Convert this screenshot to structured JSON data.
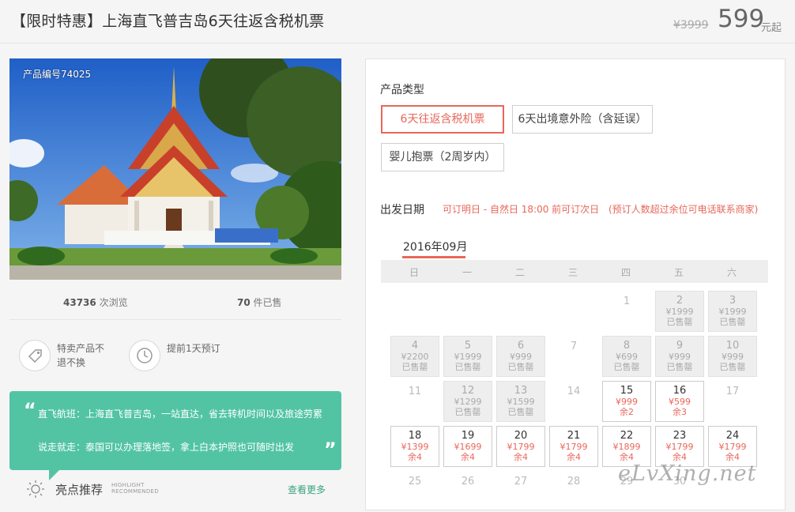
{
  "header": {
    "title": "【限时特惠】上海直飞普吉岛6天往返含税机票",
    "original_price": "¥3999",
    "price": "599",
    "price_unit": "元起"
  },
  "gallery": {
    "product_code": "产品编号74025"
  },
  "stats": {
    "views_count": "43736",
    "views_label": "次浏览",
    "sold_count": "70",
    "sold_label": "件已售"
  },
  "features": [
    {
      "icon": "tag-icon",
      "text": "特卖产品不退不换"
    },
    {
      "icon": "clock-icon",
      "text": "提前1天预订"
    }
  ],
  "quote": {
    "line1": "直飞航班：上海直飞普吉岛，一站直达，省去转机时间以及旅途劳累",
    "line2": "说走就走：泰国可以办理落地签，拿上白本护照也可随时出发"
  },
  "highlights": {
    "icon": "sun-icon",
    "title": "亮点推荐",
    "subtitle_en_1": "HIGHLIGHT",
    "subtitle_en_2": "RECOMMENDED",
    "more": "查看更多"
  },
  "booking": {
    "product_type_label": "产品类型",
    "options": [
      {
        "label": "6天往返含税机票",
        "selected": true
      },
      {
        "label": "6天出境意外险（含延误）",
        "selected": false
      },
      {
        "label": "婴儿抱票（2周岁内）",
        "selected": false
      }
    ],
    "depart_label": "出发日期",
    "depart_note1": "可订明日 - 自然日 18:00 前可订次日",
    "depart_note2": "(预订人数超过余位可电话联系商家)",
    "month": "2016年09月",
    "weekdays": [
      "日",
      "一",
      "二",
      "三",
      "四",
      "五",
      "六"
    ],
    "days": [
      {
        "day": "1",
        "state": "plain",
        "col": 4,
        "row": 0
      },
      {
        "day": "2",
        "state": "soldout",
        "price": "¥1999",
        "note": "已售罄",
        "col": 5,
        "row": 0
      },
      {
        "day": "3",
        "state": "soldout",
        "price": "¥1999",
        "note": "已售罄",
        "col": 6,
        "row": 0
      },
      {
        "day": "4",
        "state": "soldout",
        "price": "¥2200",
        "note": "已售罄",
        "col": 0,
        "row": 1
      },
      {
        "day": "5",
        "state": "soldout",
        "price": "¥1999",
        "note": "已售罄",
        "col": 1,
        "row": 1
      },
      {
        "day": "6",
        "state": "soldout",
        "price": "¥999",
        "note": "已售罄",
        "col": 2,
        "row": 1
      },
      {
        "day": "7",
        "state": "plain",
        "col": 3,
        "row": 1
      },
      {
        "day": "8",
        "state": "soldout",
        "price": "¥699",
        "note": "已售罄",
        "col": 4,
        "row": 1
      },
      {
        "day": "9",
        "state": "soldout",
        "price": "¥999",
        "note": "已售罄",
        "col": 5,
        "row": 1
      },
      {
        "day": "10",
        "state": "soldout",
        "price": "¥999",
        "note": "已售罄",
        "col": 6,
        "row": 1
      },
      {
        "day": "11",
        "state": "plain",
        "col": 0,
        "row": 2
      },
      {
        "day": "12",
        "state": "soldout",
        "price": "¥1299",
        "note": "已售罄",
        "col": 1,
        "row": 2
      },
      {
        "day": "13",
        "state": "soldout",
        "price": "¥1599",
        "note": "已售罄",
        "col": 2,
        "row": 2
      },
      {
        "day": "14",
        "state": "plain",
        "col": 3,
        "row": 2
      },
      {
        "day": "15",
        "state": "avail",
        "price": "¥999",
        "note": "余2",
        "col": 4,
        "row": 2
      },
      {
        "day": "16",
        "state": "avail",
        "price": "¥599",
        "note": "余3",
        "col": 5,
        "row": 2
      },
      {
        "day": "17",
        "state": "plain",
        "col": 6,
        "row": 2
      },
      {
        "day": "18",
        "state": "avail",
        "price": "¥1399",
        "note": "余4",
        "col": 0,
        "row": 3
      },
      {
        "day": "19",
        "state": "avail",
        "price": "¥1699",
        "note": "余4",
        "col": 1,
        "row": 3
      },
      {
        "day": "20",
        "state": "avail",
        "price": "¥1799",
        "note": "余4",
        "col": 2,
        "row": 3
      },
      {
        "day": "21",
        "state": "avail",
        "price": "¥1799",
        "note": "余4",
        "col": 3,
        "row": 3
      },
      {
        "day": "22",
        "state": "avail",
        "price": "¥1899",
        "note": "余4",
        "col": 4,
        "row": 3
      },
      {
        "day": "23",
        "state": "avail",
        "price": "¥1799",
        "note": "余4",
        "col": 5,
        "row": 3
      },
      {
        "day": "24",
        "state": "avail",
        "price": "¥1799",
        "note": "余4",
        "col": 6,
        "row": 3
      },
      {
        "day": "25",
        "state": "plain",
        "col": 0,
        "row": 4
      },
      {
        "day": "26",
        "state": "plain",
        "col": 1,
        "row": 4
      },
      {
        "day": "27",
        "state": "plain",
        "col": 2,
        "row": 4
      },
      {
        "day": "28",
        "state": "plain",
        "col": 3,
        "row": 4
      },
      {
        "day": "29",
        "state": "plain",
        "col": 4,
        "row": 4
      },
      {
        "day": "30",
        "state": "plain",
        "col": 5,
        "row": 4
      }
    ]
  },
  "watermark": "eLvXing.net",
  "colors": {
    "accent": "#e8675b",
    "quote_bg": "#52c4a4",
    "link": "#3aa37f"
  }
}
